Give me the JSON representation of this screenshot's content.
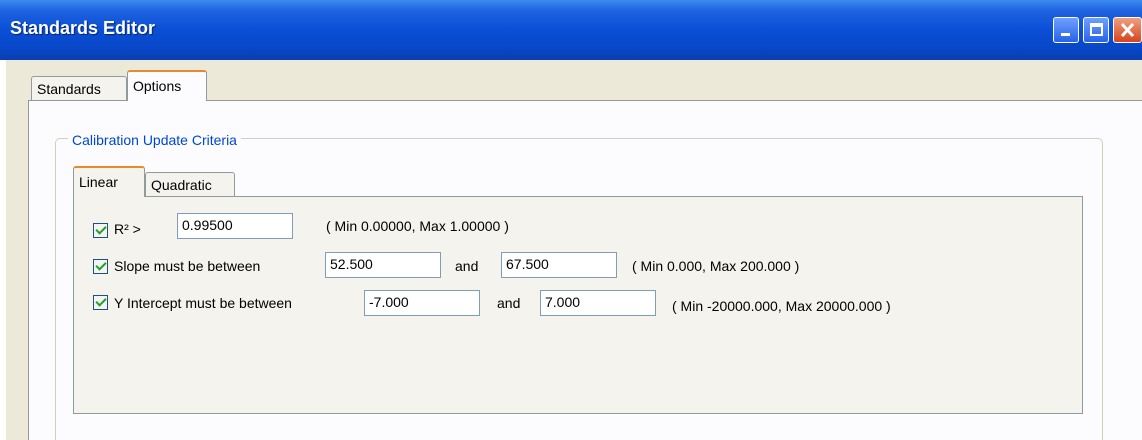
{
  "window": {
    "title": "Standards Editor"
  },
  "tabs": [
    {
      "label": "Standards"
    },
    {
      "label": "Options"
    }
  ],
  "group": {
    "legend": "Calibration Update Criteria",
    "tabs": [
      {
        "label": "Linear"
      },
      {
        "label": "Quadratic"
      }
    ],
    "criteria": [
      {
        "checked": true,
        "label": "R² >",
        "value": "0.99500",
        "range": "( Min 0.00000, Max 1.00000 )"
      },
      {
        "checked": true,
        "label": "Slope must be between",
        "min_value": "52.500",
        "and_label": "and",
        "max_value": "67.500",
        "range": "( Min 0.000, Max 200.000 )"
      },
      {
        "checked": true,
        "label": "Y Intercept must be between",
        "min_value": "-7.000",
        "and_label": "and",
        "max_value": "7.000",
        "range": "( Min -20000.000, Max 20000.000 )"
      }
    ]
  }
}
